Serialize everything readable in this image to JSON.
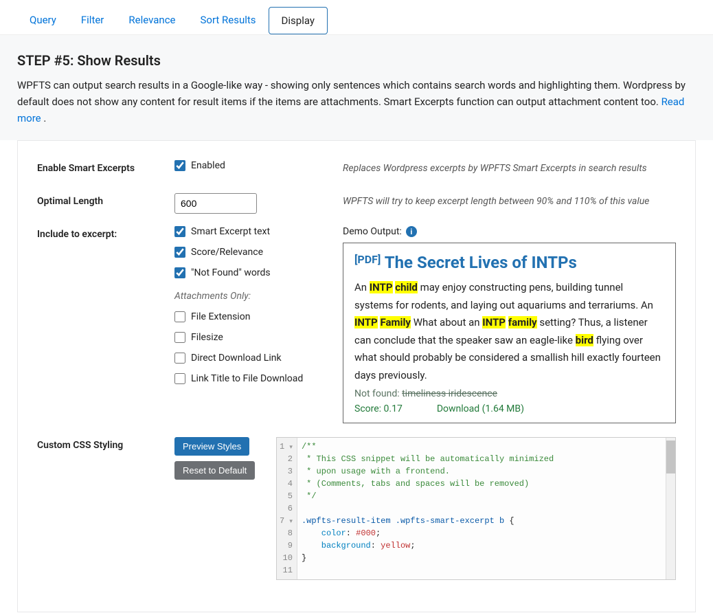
{
  "tabs": {
    "items": [
      "Query",
      "Filter",
      "Relevance",
      "Sort Results",
      "Display"
    ],
    "active_index": 4
  },
  "intro": {
    "heading": "STEP #5: Show Results",
    "text_before": "WPFTS can output search results in a Google-like way - showing only sentences which contains search words and highlighting them. Wordpress by default does not show any content for result items if the items are attachments. Smart Excerpts function can output attachment content too. ",
    "link": "Read more",
    "text_after": " ."
  },
  "fields": {
    "enable_label": "Enable Smart Excerpts",
    "enable_check": "Enabled",
    "enable_desc": "Replaces Wordpress excerpts by WPFTS Smart Excerpts in search results",
    "optimal_label": "Optimal Length",
    "optimal_value": "600",
    "optimal_desc": "WPFTS will try to keep excerpt length between 90% and 110% of this value",
    "include_label": "Include to excerpt:",
    "include_items": [
      "Smart Excerpt text",
      "Score/Relevance",
      "\"Not Found\" words"
    ],
    "attach_heading": "Attachments Only:",
    "attach_items": [
      "File Extension",
      "Filesize",
      "Direct Download Link",
      "Link Title to File Download"
    ],
    "css_label": "Custom CSS Styling",
    "btn_preview": "Preview Styles",
    "btn_reset": "Reset to Default"
  },
  "demo": {
    "label": "Demo Output:",
    "pdf_tag": "[PDF]",
    "title": "The Secret Lives of INTPs",
    "t1": "An ",
    "h1": "INTP",
    "h2": "child",
    "t2": " may enjoy constructing pens, building tunnel systems for rodents, and laying out aquariums and terrariums. An ",
    "h3": "INTP",
    "h4": "Family",
    "t3": " What about an ",
    "h5": "INTP",
    "h6": "family",
    "t4": " setting? Thus, a listener can conclude that the speaker saw an eagle-like ",
    "h7": "bird",
    "t5": " flying over what should probably be considered a smallish hill exactly fourteen days previously.",
    "notfound_label": "Not found: ",
    "notfound_words": "timeliness iridescence",
    "score": "Score: 0.17",
    "download": "Download (1.64 MB)"
  },
  "code": {
    "l1": "/**",
    "l2": " * This CSS snippet will be automatically minimized",
    "l3": " * upon usage with a frontend.",
    "l4": " * (Comments, tabs and spaces will be removed)",
    "l5": " */",
    "l6": "",
    "l7a": ".wpfts-result-item .wpfts-smart-excerpt b",
    "l7b": " {",
    "l8a": "color",
    "l8b": ": ",
    "l8c": "#000",
    "l8d": ";",
    "l9a": "background",
    "l9b": ": ",
    "l9c": "yellow",
    "l9d": ";",
    "l10": "}"
  }
}
